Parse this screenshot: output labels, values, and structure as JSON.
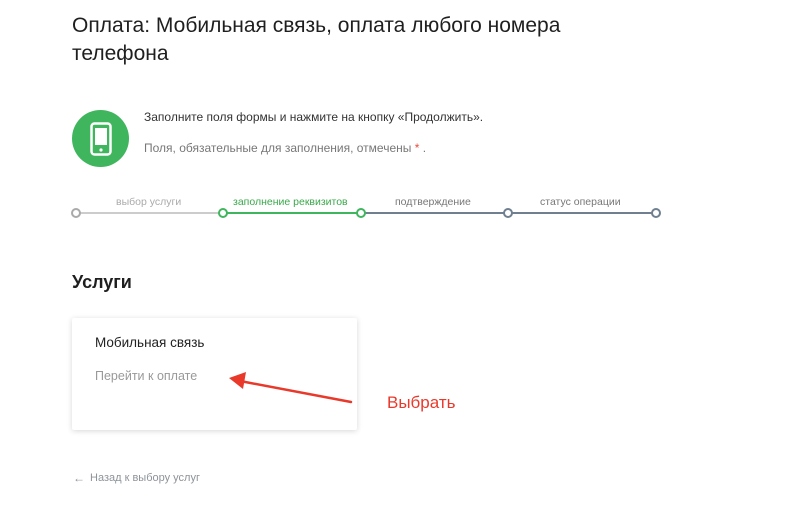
{
  "page": {
    "title": "Оплата: Мобильная связь, оплата любого номера телефона"
  },
  "info": {
    "icon": "mobile-phone-icon",
    "line1": "Заполните поля формы и нажмите на кнопку «Продолжить».",
    "line2_prefix": "Поля, обязательные для заполнения, отмечены",
    "required_mark": "*",
    "line2_suffix": "."
  },
  "steps": [
    {
      "label": "выбор услуги",
      "state": "done"
    },
    {
      "label": "заполнение реквизитов",
      "state": "active"
    },
    {
      "label": "подтверждение",
      "state": "pending"
    },
    {
      "label": "статус операции",
      "state": "pending"
    }
  ],
  "services": {
    "heading": "Услуги",
    "cards": [
      {
        "title": "Мобильная связь",
        "link": "Перейти к оплате"
      }
    ]
  },
  "annotation": {
    "text": "Выбрать"
  },
  "back_link": {
    "label": "Назад к выбору услуг"
  },
  "colors": {
    "accent_green": "#3fb55d",
    "done_gray": "#cccccc",
    "pending_slate": "#6f7f8f",
    "annotation_red": "#e8392b"
  }
}
